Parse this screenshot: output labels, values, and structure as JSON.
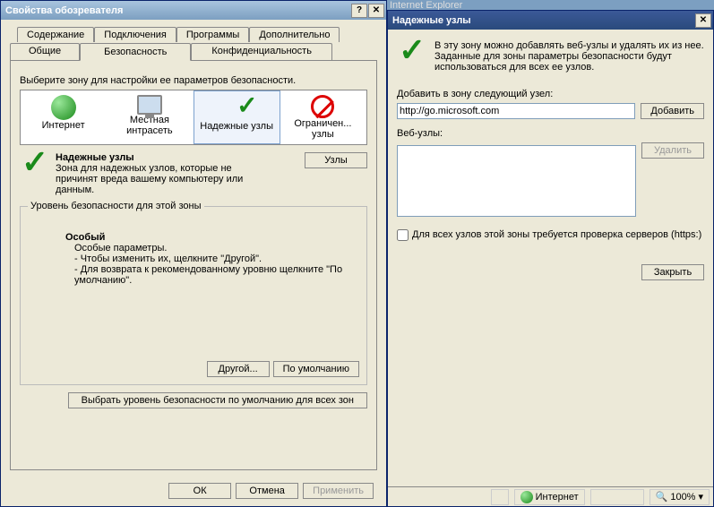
{
  "dlg1": {
    "title": "Свойства обозревателя",
    "tabs_top": [
      "Содержание",
      "Подключения",
      "Программы",
      "Дополнительно"
    ],
    "tabs_bot": [
      "Общие",
      "Безопасность",
      "Конфиденциальность"
    ],
    "zone_prompt": "Выберите зону для настройки ее параметров безопасности.",
    "zones": [
      {
        "name": "Интернет"
      },
      {
        "name": "Местная интрасеть"
      },
      {
        "name": "Надежные узлы"
      },
      {
        "name": "Ограничен... узлы"
      }
    ],
    "sel_title": "Надежные узлы",
    "sel_desc": "Зона для надежных узлов, которые не причинят вреда вашему компьютеру или данным.",
    "btn_sites": "Узлы",
    "level_legend": "Уровень безопасности для этой зоны",
    "level_name": "Особый",
    "level_l1": "Особые параметры.",
    "level_l2": "- Чтобы изменить их, щелкните \"Другой\".",
    "level_l3": "- Для возврата к рекомендованному уровню щелкните \"По умолчанию\".",
    "btn_custom": "Другой...",
    "btn_default": "По умолчанию",
    "btn_reset": "Выбрать уровень безопасности по умолчанию для всех зон",
    "ok": "ОК",
    "cancel": "Отмена",
    "apply": "Применить"
  },
  "dlg2": {
    "title": "Надежные узлы",
    "intro": "В эту зону можно добавлять веб-узлы и удалять их из нее. Заданные для зоны параметры безопасности будут использоваться для всех ее узлов.",
    "add_label": "Добавить в зону следующий узел:",
    "add_value": "http://go.microsoft.com",
    "btn_add": "Добавить",
    "list_label": "Веб-узлы:",
    "btn_del": "Удалить",
    "chk": "Для всех узлов этой зоны требуется проверка серверов (https:)",
    "btn_close": "Закрыть"
  },
  "ie_title": "Internet Explorer",
  "status": {
    "zone": "Интернет",
    "zoom": "100%"
  }
}
